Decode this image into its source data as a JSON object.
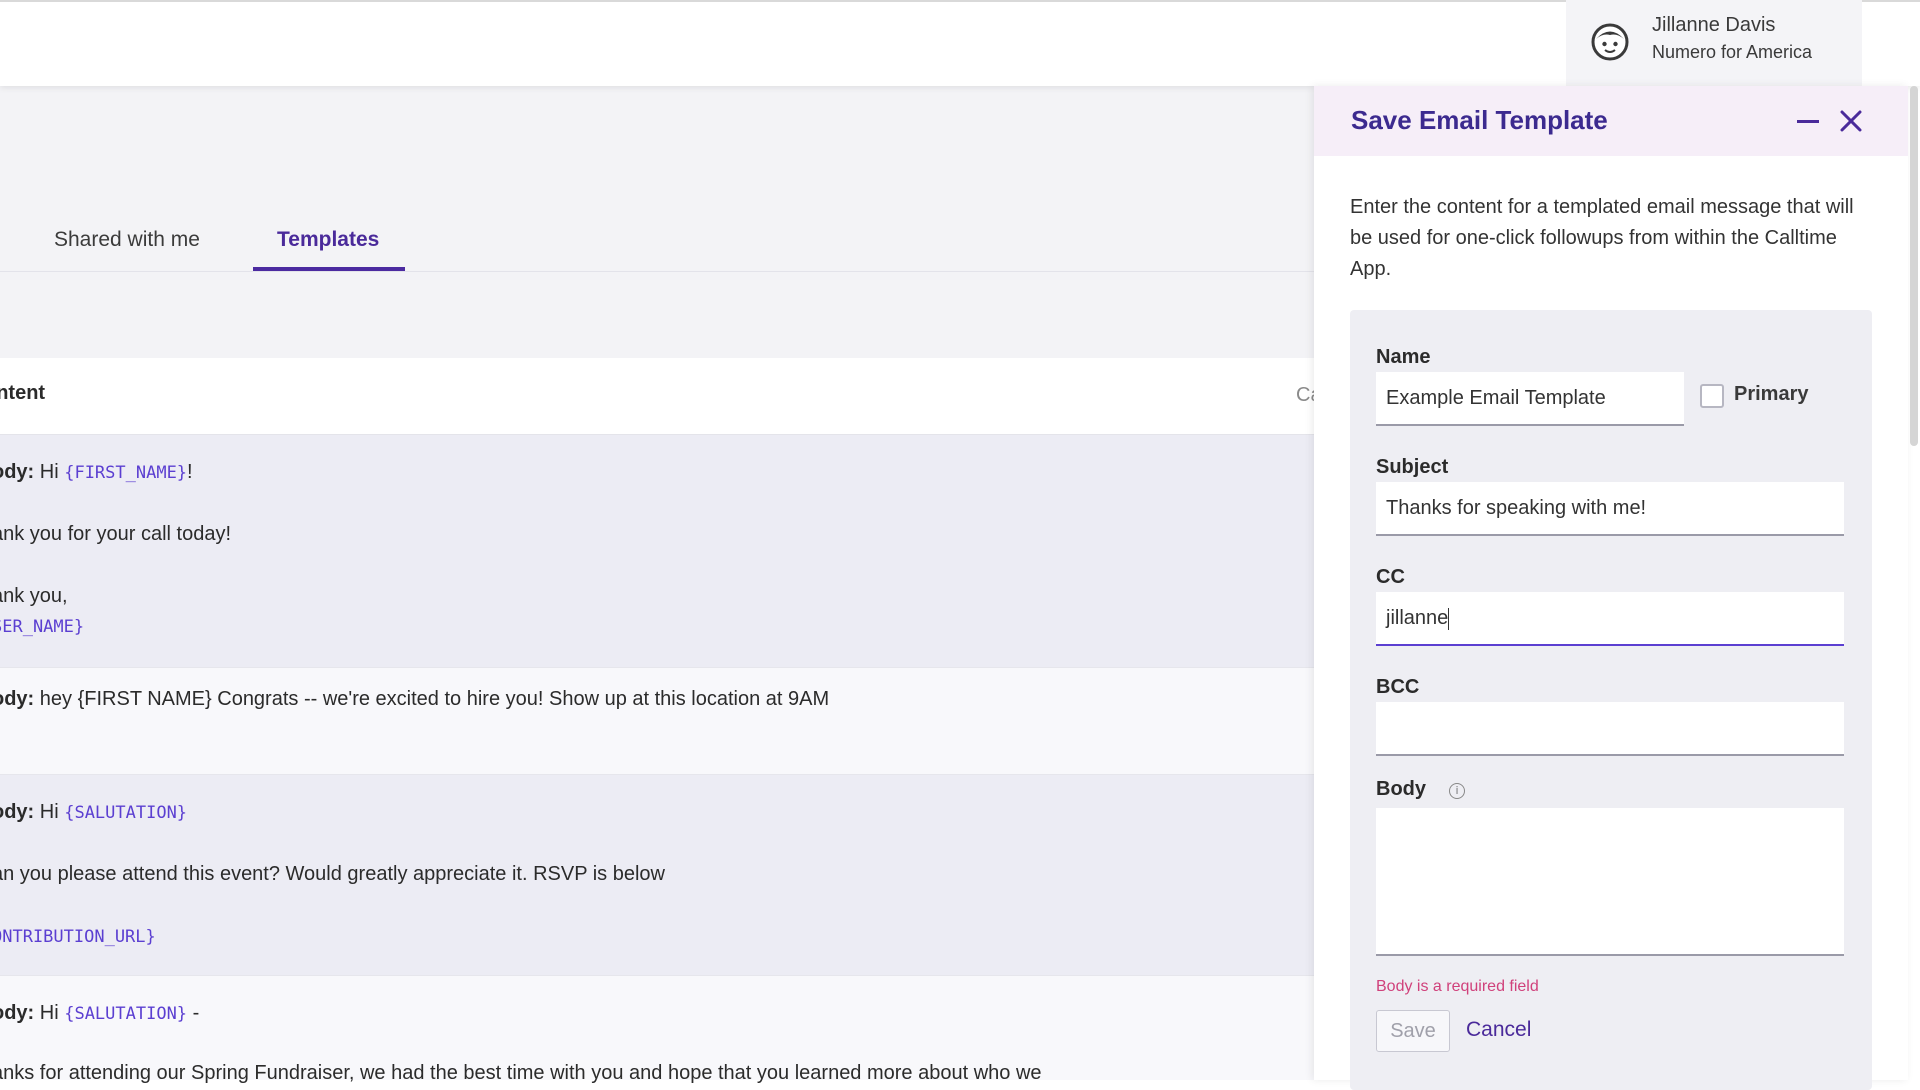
{
  "user": {
    "name": "Jillanne Davis",
    "org": "Numero for America",
    "avatar_icon": "user-face-icon"
  },
  "tabs": [
    {
      "label": "Shared with me",
      "active": false
    },
    {
      "label": "Templates",
      "active": true
    }
  ],
  "table": {
    "header": {
      "content": "ontent",
      "next_col": "Ca"
    },
    "rows": [
      {
        "lines": [
          {
            "prefix": "ody:",
            "text": " Hi ",
            "var": "{FIRST_NAME}",
            "suffix": "!"
          },
          {
            "text": "ank you for your call today!"
          },
          {
            "text": "ank you,"
          },
          {
            "var": "SER_NAME}"
          }
        ]
      },
      {
        "lines": [
          {
            "prefix": "ody:",
            "text": " hey {FIRST NAME} Congrats -- we're excited to hire you! Show up at this location at 9AM"
          }
        ]
      },
      {
        "lines": [
          {
            "prefix": "ody:",
            "text": " Hi ",
            "var": "{SALUTATION}"
          },
          {
            "text": "an you please attend this event? Would greatly appreciate it. RSVP is below"
          },
          {
            "var": "ONTRIBUTION_URL}"
          }
        ]
      },
      {
        "lines": [
          {
            "prefix": "ody:",
            "text": " Hi ",
            "var": "{SALUTATION}",
            "suffix": " -"
          },
          {
            "text": "anks for attending our Spring Fundraiser, we had the best time with you and hope that you learned more about who we"
          }
        ]
      }
    ]
  },
  "panel": {
    "title": "Save Email Template",
    "description": "Enter the content for a templated email message that will be used for one-click followups from within the Calltime App.",
    "fields": {
      "name_label": "Name",
      "name_value": "Example Email Template",
      "primary_label": "Primary",
      "primary_checked": false,
      "subject_label": "Subject",
      "subject_value": "Thanks for speaking with me!",
      "cc_label": "CC",
      "cc_value": "jillanne",
      "bcc_label": "BCC",
      "bcc_value": "",
      "body_label": "Body",
      "body_value": ""
    },
    "error": "Body is a required field",
    "save_label": "Save",
    "cancel_label": "Cancel"
  },
  "colors": {
    "accent": "#4a2a9a",
    "variable": "#5b3fd1",
    "error": "#d0417b"
  }
}
